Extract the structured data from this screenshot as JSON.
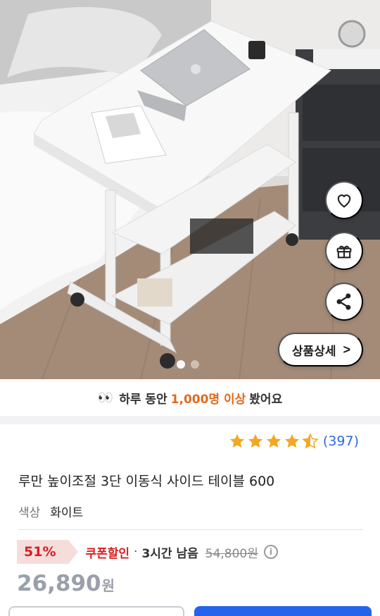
{
  "hero": {
    "image_alt": "white height-adjustable 3-tier side table with laptop",
    "actions": {
      "like_icon": "heart-icon",
      "gift_icon": "gift-icon",
      "share_icon": "share-icon"
    },
    "detail_button_label": "상품상세",
    "detail_button_chevron": ">",
    "pager": {
      "current": 1,
      "total": 2
    }
  },
  "viewers": {
    "eyes": "👀",
    "prefix": "하루 동안",
    "highlight": "1,000명 이상",
    "suffix": "봤어요"
  },
  "rating": {
    "stars": 4.5,
    "count": "(397)",
    "star_color": "#f5a623"
  },
  "product": {
    "title": "루만 높이조절 3단 이동식 사이드 테이블 600",
    "option_key": "색상",
    "option_value": "화이트"
  },
  "pricing": {
    "discount_pct": "51%",
    "coupon_label": "쿠폰할인",
    "separator": "·",
    "timer": "3시간 남음",
    "original_price": "54,800원",
    "info_icon": "i",
    "price_number": "26,890",
    "price_unit": "원",
    "accent_color": "#d71e1e",
    "cta_color": "#2463eb"
  }
}
